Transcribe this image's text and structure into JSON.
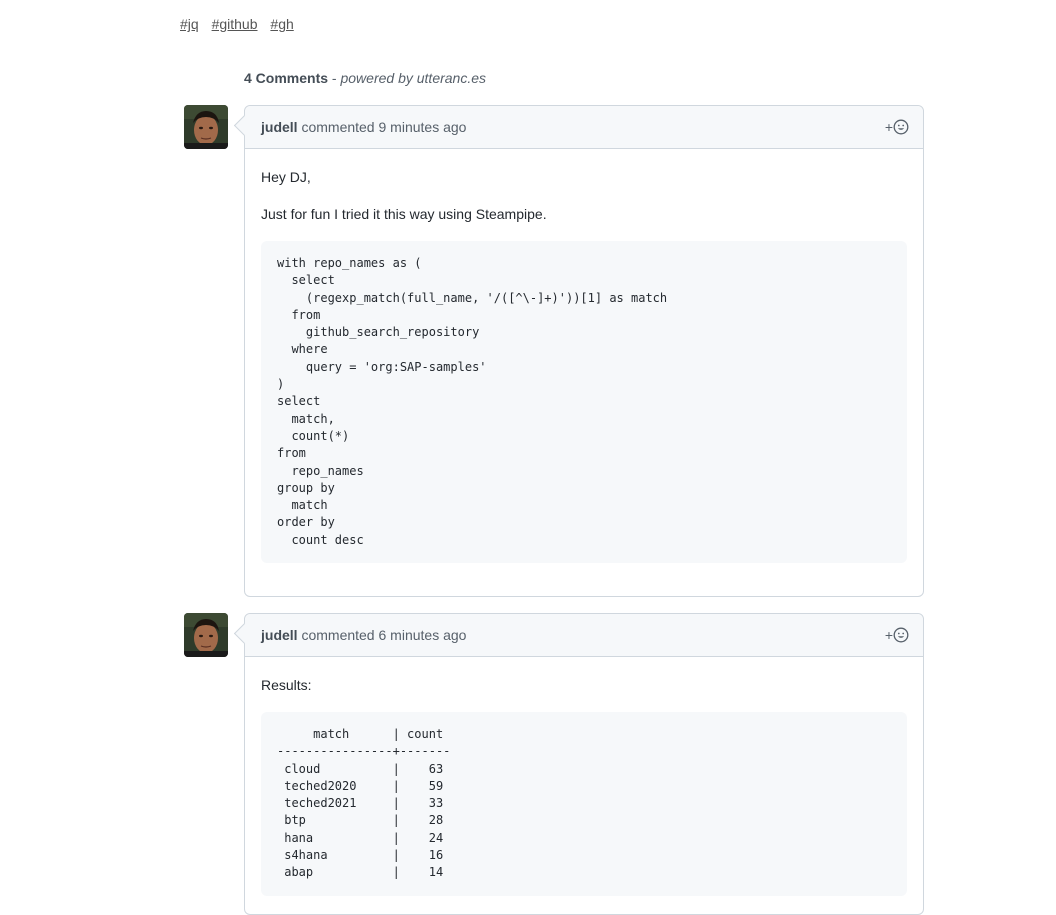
{
  "tags": [
    "#jq",
    "#github",
    "#gh"
  ],
  "comments_header": {
    "count": "4 Comments",
    "separator": " - ",
    "powered_by": "powered by utteranc.es"
  },
  "comments": [
    {
      "author": "judell",
      "action": " commented ",
      "time": "9 minutes ago",
      "reaction_plus": "+",
      "paragraphs": [
        "Hey DJ,",
        "Just for fun I tried it this way using Steampipe."
      ],
      "code": "with repo_names as (\n  select\n    (regexp_match(full_name, '/([^\\-]+)'))[1] as match\n  from\n    github_search_repository\n  where\n    query = 'org:SAP-samples'\n)\nselect\n  match,\n  count(*)\nfrom\n  repo_names\ngroup by\n  match\norder by\n  count desc"
    },
    {
      "author": "judell",
      "action": " commented ",
      "time": "6 minutes ago",
      "reaction_plus": "+",
      "paragraphs": [
        "Results:"
      ],
      "code": "     match      | count\n----------------+-------\n cloud          |    63\n teched2020     |    59\n teched2021     |    33\n btp            |    28\n hana           |    24\n s4hana         |    16\n abap           |    14"
    }
  ]
}
